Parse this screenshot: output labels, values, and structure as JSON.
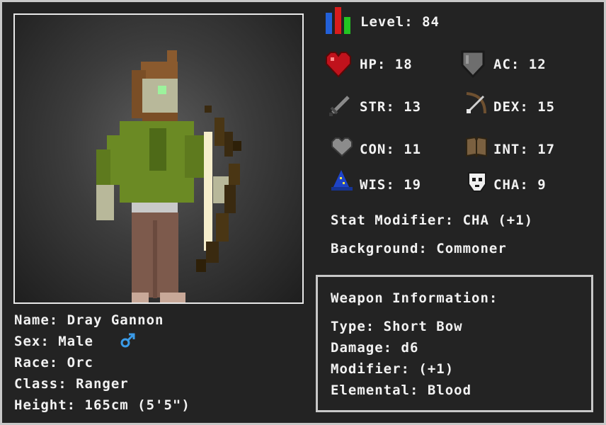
{
  "character": {
    "name_line": "Name: Dray Gannon",
    "sex_line": "Sex: Male",
    "race_line": "Race: Orc",
    "class_line": "Class: Ranger",
    "height_line": "Height: 165cm (5'5\")"
  },
  "stats": {
    "level_line": "Level: 84",
    "hp_line": "HP: 18",
    "ac_line": "AC: 12",
    "str_line": "STR: 13",
    "dex_line": "DEX: 15",
    "con_line": "CON: 11",
    "int_line": "INT: 17",
    "wis_line": "WIS: 19",
    "cha_line": "CHA: 9",
    "modifier_line": "Stat Modifier: CHA (+1)",
    "background_line": "Background: Commoner"
  },
  "weapon": {
    "title": "Weapon Information:",
    "type_line": "Type: Short Bow",
    "damage_line": "Damage: d6",
    "modifier_line": "Modifier: (+1)",
    "elemental_line": "Elemental: Blood"
  },
  "icons": {
    "level": "bar-chart-icon",
    "hp": "heart-icon",
    "ac": "shield-icon",
    "str": "sword-icon",
    "dex": "bow-arrow-icon",
    "con": "grey-heart-icon",
    "int": "book-icon",
    "wis": "wizard-hat-icon",
    "cha": "skull-mask-icon",
    "sex": "male-symbol-icon"
  },
  "colors": {
    "background": "#232323",
    "border": "#c8c8c8",
    "text": "#f2f2f2",
    "male_symbol": "#3a9be8",
    "heart": "#c0121c"
  }
}
